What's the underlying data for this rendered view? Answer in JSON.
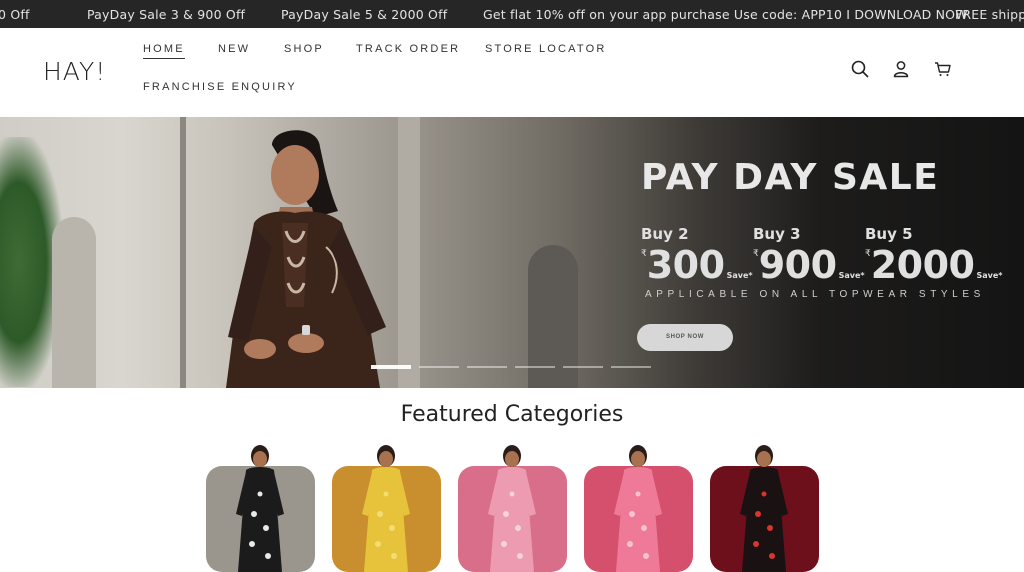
{
  "announcements": [
    "0 Off",
    "PayDay Sale 3 & 900 Off",
    "PayDay Sale 5 & 2000 Off",
    "Get flat 10% off on your app purchase Use code: APP10 I DOWNLOAD NOW",
    "FREE shippin"
  ],
  "header": {
    "logo": "HAY!",
    "nav": [
      "HOME",
      "NEW",
      "SHOP",
      "TRACK ORDER",
      "STORE LOCATOR",
      "FRANCHISE ENQUIRY"
    ],
    "active_nav": "HOME",
    "icons": [
      "search-icon",
      "account-icon",
      "cart-icon"
    ]
  },
  "hero": {
    "title": "PAY DAY SALE",
    "offers": [
      {
        "buy": "Buy 2",
        "currency": "₹",
        "amount": "300",
        "save": "Save*"
      },
      {
        "buy": "Buy 3",
        "currency": "₹",
        "amount": "900",
        "save": "Save*"
      },
      {
        "buy": "Buy 5",
        "currency": "₹",
        "amount": "2000",
        "save": "Save*"
      }
    ],
    "subtitle": "APPLICABLE ON ALL TOPWEAR STYLES",
    "cta": "SHOP NOW",
    "slide_count": 6,
    "active_slide": 1
  },
  "featured": {
    "title": "Featured Categories",
    "categories": [
      {
        "bg": "#9a958d",
        "dress": "#1b1b1b",
        "print": "#e9e9e9"
      },
      {
        "bg": "#c98e2e",
        "dress": "#e7c23b",
        "print": "#f3dc77"
      },
      {
        "bg": "#d86e8a",
        "dress": "#ec9bb0",
        "print": "#f6d2dc"
      },
      {
        "bg": "#d4506c",
        "dress": "#ef7a98",
        "print": "#f8c3d0"
      },
      {
        "bg": "#6e0f1c",
        "dress": "#1a1212",
        "print": "#d9342e"
      }
    ]
  },
  "colors": {
    "announce_bg": "#262626",
    "text": "#222222"
  }
}
